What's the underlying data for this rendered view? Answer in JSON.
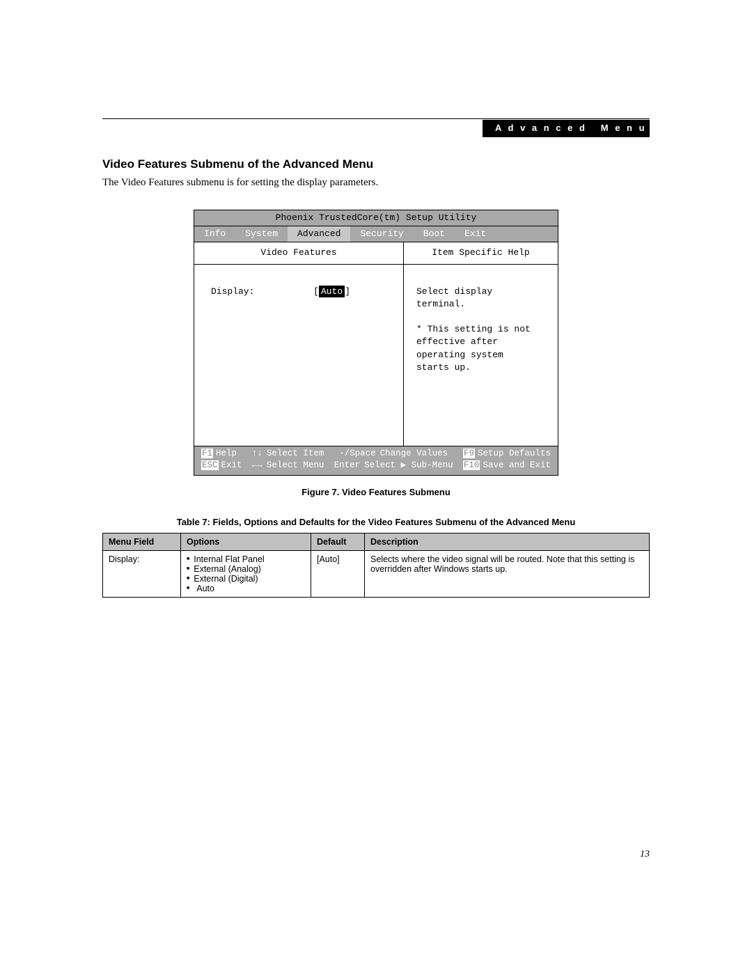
{
  "header_badge": "Advanced Menu",
  "title": "Video Features Submenu of the Advanced Menu",
  "intro": "The Video Features submenu is for setting the display parameters.",
  "bios": {
    "title": "Phoenix TrustedCore(tm) Setup Utility",
    "tabs": [
      "Info",
      "System",
      "Advanced",
      "Security",
      "Boot",
      "Exit"
    ],
    "active_tab_index": 2,
    "submenu_label": "Video Features",
    "help_panel_label": "Item Specific Help",
    "setting_label": "Display:",
    "setting_value": "Auto",
    "help_text": "Select display terminal.\n\n* This setting is not\neffective after\noperating system\nstarts up.",
    "footer": {
      "f1": "F1",
      "help_label": "Help",
      "select_item": "Select Item",
      "change_values_key": "-/Space",
      "change_values": "Change Values",
      "f9": "F9",
      "setup_defaults": "Setup Defaults",
      "esc": "ESC",
      "exit_label": "Exit",
      "select_menu": "Select Menu",
      "enter": "Enter",
      "select_submenu": "Select ▶ Sub-Menu",
      "f10": "F10",
      "save_exit": "Save and Exit"
    }
  },
  "figure_caption": "Figure 7.  Video Features Submenu",
  "table_caption": "Table 7: Fields, Options and Defaults for the Video Features Submenu of the Advanced Menu",
  "table": {
    "headers": [
      "Menu Field",
      "Options",
      "Default",
      "Description"
    ],
    "row": {
      "menu_field": "Display:",
      "options": [
        "Internal Flat Panel",
        "External (Analog)",
        "External (Digital)",
        "Auto"
      ],
      "default": "[Auto]",
      "description": "Selects where the video signal will be routed. Note that this setting is overridden after Windows starts up."
    }
  },
  "page_number": "13"
}
